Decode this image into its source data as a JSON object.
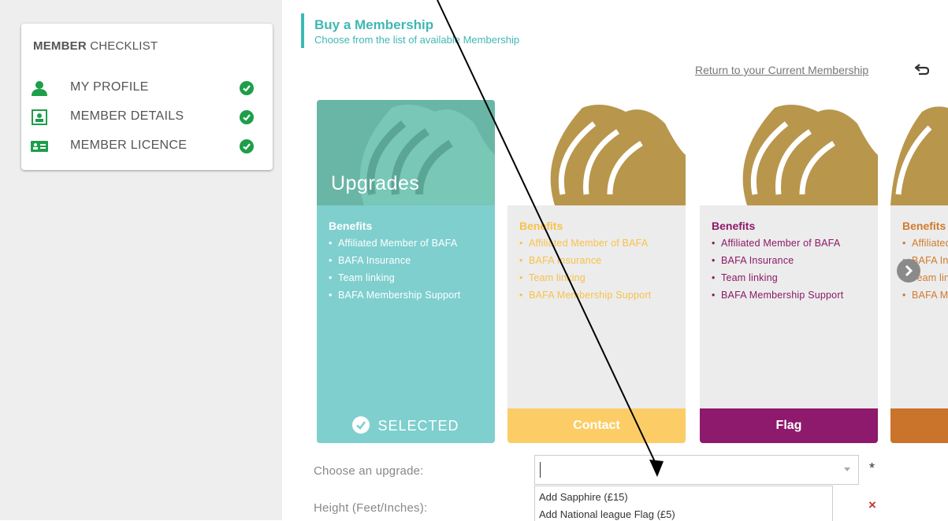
{
  "sidebar": {
    "title_bold": "MEMBER",
    "title_rest": " CHECKLIST",
    "items": [
      {
        "label": "MY PROFILE",
        "icon": "person-icon"
      },
      {
        "label": "MEMBER DETAILS",
        "icon": "id-card-icon"
      },
      {
        "label": "MEMBER LICENCE",
        "icon": "licence-card-icon"
      }
    ],
    "check_color": "#1e9e4a"
  },
  "header": {
    "title": "Buy a Membership",
    "subtitle": "Choose from the list of available Membership",
    "return_link": "Return to your Current Membership"
  },
  "cards": [
    {
      "heading": "Upgrades",
      "benefits_title": "Benefits",
      "benefits": [
        "Affiliated Member of BAFA",
        "BAFA Insurance",
        "Team linking",
        "BAFA Membership Support"
      ],
      "footer": "SELECTED",
      "accent": "#7fcfcf"
    },
    {
      "benefits_title": "Benefits",
      "benefits": [
        "Affiliated Member of BAFA",
        "BAFA Insurance",
        "Team linking",
        "BAFA Membership Support"
      ],
      "footer": "Contact",
      "accent": "#fccd66"
    },
    {
      "benefits_title": "Benefits",
      "benefits": [
        "Affiliated Member of BAFA",
        "BAFA Insurance",
        "Team linking",
        "BAFA Membership Support"
      ],
      "footer": "Flag",
      "accent": "#8d1a6c"
    },
    {
      "benefits_title": "Benefits",
      "benefits": [
        "Affiliated Member of BAFA",
        "BAFA Insurance",
        "Team linking",
        "BAFA Membership Support"
      ],
      "footer": "",
      "accent": "#c9732b"
    }
  ],
  "form": {
    "upgrade_label": "Choose an upgrade:",
    "height_label": "Height (Feet/Inches):",
    "required_mark": "*",
    "error_mark": "×",
    "options": [
      "Add Sapphire (£15)",
      "Add National league Flag (£5)"
    ]
  }
}
